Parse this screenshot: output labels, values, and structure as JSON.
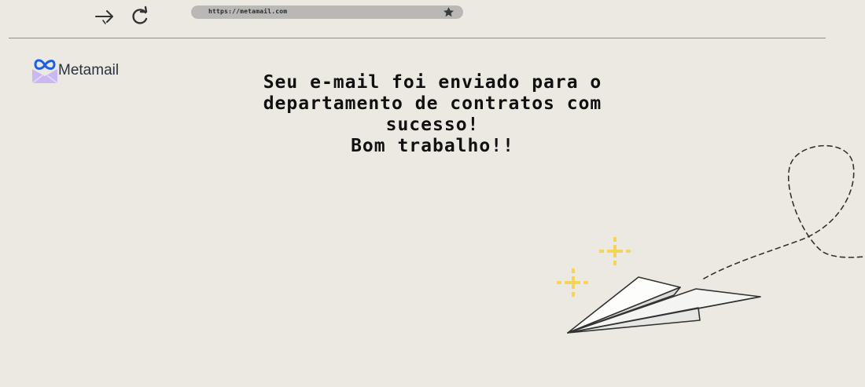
{
  "browser": {
    "url": "https://metamail.com",
    "forward_icon": "arrow-right-icon",
    "reload_icon": "reload-icon",
    "bookmark_icon": "star-icon"
  },
  "brand": {
    "name": "Metamail",
    "logo_icon": "meta-infinity-envelope-icon",
    "colors": {
      "logo_blue": "#1f5fe8",
      "envelope": "#c9b8f2"
    }
  },
  "message": {
    "line1": "Seu e-mail foi enviado para o",
    "line2": "departamento de contratos com",
    "line3": "sucesso!",
    "line4": "Bom trabalho!!"
  },
  "illustration": {
    "paper_plane_icon": "paper-plane-icon",
    "sparkle_icon": "sparkle-icon",
    "sparkle_color": "#f6d35c"
  }
}
